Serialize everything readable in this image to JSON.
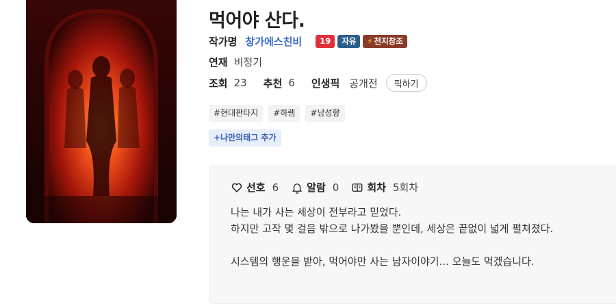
{
  "novel": {
    "title": "먹어야 산다.",
    "author_label": "작가명",
    "author": "창가에스친비",
    "badges": {
      "age": "19",
      "free": "자유",
      "contest": "천지창조"
    },
    "serial_label": "연재",
    "serial_value": "비정기",
    "views_label": "조회",
    "views": "23",
    "recommend_label": "추천",
    "recommend": "6",
    "life_pick_label": "인생픽",
    "life_pick_value": "공개전",
    "pick_button": "픽하기"
  },
  "tags": [
    "#현대판타지",
    "#하렘",
    "#남성향"
  ],
  "add_tag_label": "+나만의태그 추가",
  "panel": {
    "likes_label": "선호",
    "likes": "6",
    "alarm_label": "알람",
    "alarm": "0",
    "episodes_label": "회차",
    "episodes": "5회차",
    "synopsis": [
      "나는 내가 사는 세상이 전부라고 믿었다.",
      "하지만 고작 몇 걸음 밖으로 나가봤을 뿐인데, 세상은 끝없이 넓게 펼쳐졌다.",
      "시스템의 행운을 받아, 먹어야만 사는 남자이야기... 오늘도 먹겠습니다."
    ]
  },
  "colors": {
    "author_link": "#3b6cc9",
    "badge_age": "#e0303a",
    "badge_free": "#2a5f8c",
    "badge_contest": "#8a3a28",
    "tag_add": "#3a5fb5"
  },
  "icons": {
    "cover": "cover-image",
    "likes": "heart-icon",
    "alarm": "bell-icon",
    "episodes": "book-icon",
    "contest": "lightning-icon"
  }
}
